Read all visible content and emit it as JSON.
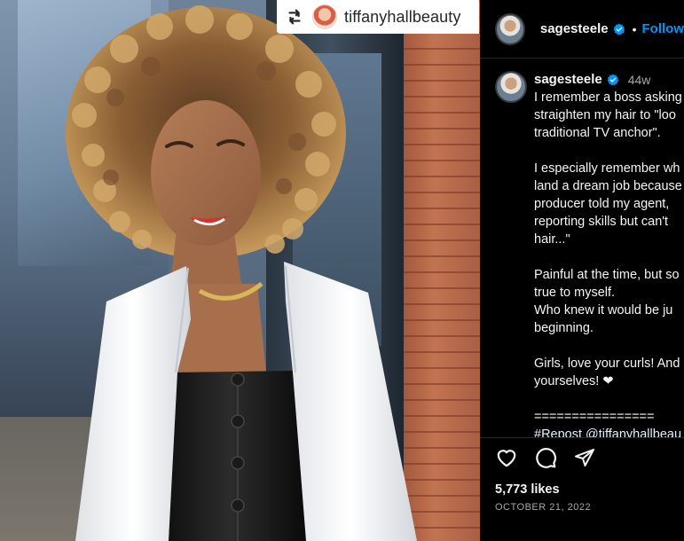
{
  "post": {
    "image_alt": "Woman with curly hair wearing a white blazer and black leather top",
    "repost": {
      "icon": "repost-icon",
      "username": "tiffanyhallbeauty"
    }
  },
  "header": {
    "username": "sagesteele",
    "separator": "•",
    "follow_label": "Follow",
    "accent_color": "#0095f6"
  },
  "caption": {
    "username": "sagesteele",
    "time": "44w",
    "lines": [
      "I remember a boss asking",
      "straighten my hair to \"loo",
      "traditional TV anchor\".",
      "",
      "I especially remember wh",
      "land a dream job because",
      "producer told my agent,",
      "reporting skills but can't",
      "hair...\"",
      "",
      "Painful at the time, but so",
      "true to myself.",
      "Who knew it would be ju",
      "beginning.",
      "",
      "Girls, love your curls! And",
      "yourselves! ❤",
      "",
      "================",
      "#Repost @tiffanyhallbeau"
    ]
  },
  "actions": {
    "like": "heart-icon",
    "comment": "comment-icon",
    "share": "share-icon"
  },
  "likes": "5,773 likes",
  "date": "OCTOBER 21, 2022"
}
